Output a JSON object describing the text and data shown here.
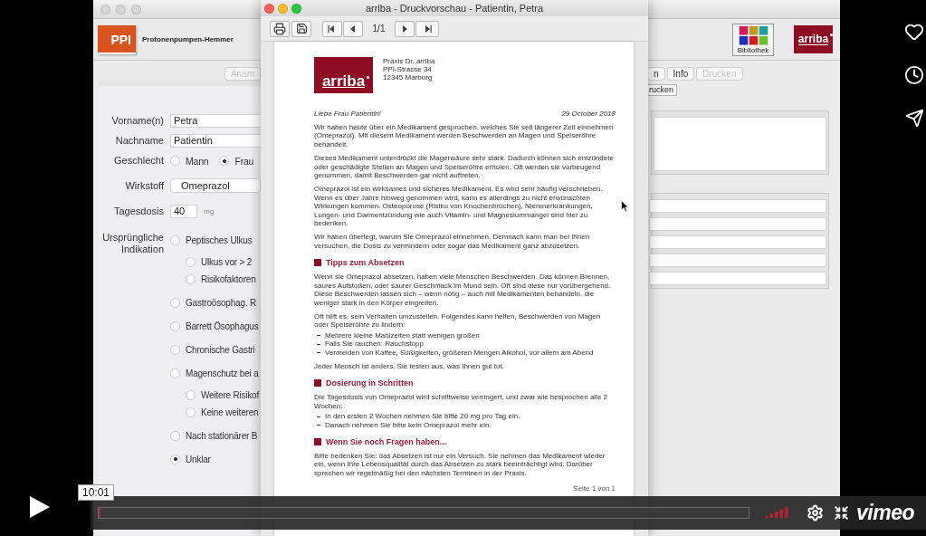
{
  "video_player": {
    "time_tooltip": "10:01",
    "logo": "vimeo",
    "progress": {
      "level": 0.003
    }
  },
  "app_window": {
    "header": {
      "logo": "PPI",
      "title": "Protonenpumpen-Hemmer",
      "library_label": "Bibliothek",
      "brand_logo": "arriba"
    },
    "tabs": [
      {
        "label": "Anam",
        "selected": false,
        "disabled": true
      },
      {
        "label": "n",
        "selected": false,
        "disabled": false
      },
      {
        "label": "Info",
        "selected": false,
        "disabled": false
      },
      {
        "label": "Drucken",
        "selected": false,
        "disabled": true
      }
    ],
    "print_button": "rucken",
    "form": {
      "fields": [
        {
          "kind": "text",
          "label": "Vorname(n)",
          "value": "Petra"
        },
        {
          "kind": "text",
          "label": "Nachname",
          "value": "Patientin"
        },
        {
          "kind": "radio",
          "label": "Geschlecht",
          "options": [
            {
              "label": "Mann",
              "selected": false
            },
            {
              "label": "Frau",
              "selected": true
            }
          ]
        },
        {
          "kind": "select",
          "label": "Wirkstoff",
          "value": "Omeprazol"
        },
        {
          "kind": "number",
          "label": "Tagesdosis",
          "value": "40",
          "unit": "mg"
        },
        {
          "kind": "radio_list",
          "label": "Ursprüngliche Indikation",
          "options": [
            {
              "label": "Peptisches Ulkus",
              "selected": false,
              "children": [
                {
                  "label": "Ulkus vor > 2",
                  "selected": false
                },
                {
                  "label": "Risikofaktoren",
                  "selected": false
                }
              ]
            },
            {
              "label": "Gastroösophag. R",
              "selected": false
            },
            {
              "label": "Barrett Ösophagus",
              "selected": false
            },
            {
              "label": "Chronische Gastri",
              "selected": false
            },
            {
              "label": "Magenschutz bei a",
              "selected": false,
              "children": [
                {
                  "label": "Weitere Risikof",
                  "selected": false
                },
                {
                  "label": "Keine weiteren",
                  "selected": false
                }
              ]
            },
            {
              "label": "Nach stationärer B",
              "selected": false
            },
            {
              "label": "Unklar",
              "selected": true
            }
          ]
        }
      ]
    }
  },
  "preview_window": {
    "title": "arriba - Druckvorschau - Patientin, Petra",
    "page_indicator": "1/1",
    "letter": {
      "logo": "arriba",
      "sender": [
        "Praxis Dr. arriba",
        "PPI-Strasse 34",
        "12345 Marburg"
      ],
      "greeting": "Liebe Frau Patientin!",
      "date": "29 October 2018",
      "blocks": [
        {
          "kind": "paragraph",
          "text": "Wir haben heute über ein Medikament gesprochen, welches Sie seit längerer Zeit einnehmen (Omeprazol). Mit diesem Medikament werden Beschwerden an Magen und Speiseröhre behandelt."
        },
        {
          "kind": "paragraph",
          "text": "Dieses Medikament unterdrückt die Magensäure sehr stark. Dadurch können sich entzündete oder geschädigte Stellen an Magen und Speiseröhre erholen. Oft werden sie vorbeugend genommen, damit Beschwerden gar nicht auftreten."
        },
        {
          "kind": "paragraph",
          "text": "Omeprazol ist ein wirksames und sicheres Medikament. Es wird sehr häufig verschrieben. Wenn es über Jahre hinweg genommen wird, kann es allerdings zu nicht erwünschten Wirkungen kommen. Osteoporose (Risiko von Knochenbrüchen), Nierenerkrankungen, Lungen- und Darmentzündung wie auch Vitamin- und Magnesiummangel sind hier zu bedenken."
        },
        {
          "kind": "paragraph",
          "text": "Wir haben überlegt, warum Sie Omeprazol einnehmen. Demnach kann man bei Ihnen versuchen, die Dosis zu vermindern oder sogar das Medikament ganz abzusetzen."
        },
        {
          "kind": "heading",
          "text": "Tipps zum Absetzen"
        },
        {
          "kind": "paragraph",
          "text": "Wenn sie Omeprazol absetzen, haben viele Menschen Beschwerden. Das können Brennen, saures Aufstoßen, oder saurer Geschmack im Mund sein. Oft sind diese nur vorübergehend. Diese Beschwerden lassen sich – wenn nötig – auch mit Medikamenten behandeln, die weniger stark in den Körper eingreifen."
        },
        {
          "kind": "paragraph",
          "text": "Oft hilft es, sein Verhalten umzustellen. Folgendes kann helfen, Beschwerden von Magen oder Speiseröhre zu lindern:"
        },
        {
          "kind": "list",
          "items": [
            "Mehrere kleine Mahlzeiten statt wenigen großen",
            "Falls Sie rauchen: Rauchstopp",
            "Vermeiden von Kaffee, Süßigkeiten, größeren Mengen Alkohol, vor allem am Abend"
          ]
        },
        {
          "kind": "paragraph",
          "text": "Jeder Mensch ist anders. Sie testen aus, was Ihnen gut tut."
        },
        {
          "kind": "heading",
          "text": "Dosierung in Schritten"
        },
        {
          "kind": "paragraph",
          "text": "Die Tagesdosis von Omeprazol wird schrittweise verringert, und zwar wie besprochen alle 2 Wochen:"
        },
        {
          "kind": "list",
          "items": [
            "In den ersten 2 Wochen nehmen Sie bitte 20 mg pro Tag ein.",
            "Danach nehmen Sie bitte kein Omeprazol mehr ein."
          ]
        },
        {
          "kind": "heading",
          "text": "Wenn Sie noch Fragen haben..."
        },
        {
          "kind": "paragraph",
          "text": "Bitte bedenken Sie: das Absetzen ist nur ein Versuch. Sie nehmen das Medikament wieder ein, wenn Ihre Lebensqualität durch das Absetzen zu stark beeinträchtigt wird. Darüber sprechen wir regelmäßig bei den nächsten Terminen in der Praxis."
        }
      ]
    },
    "footer": "Seite 1 von 1"
  }
}
